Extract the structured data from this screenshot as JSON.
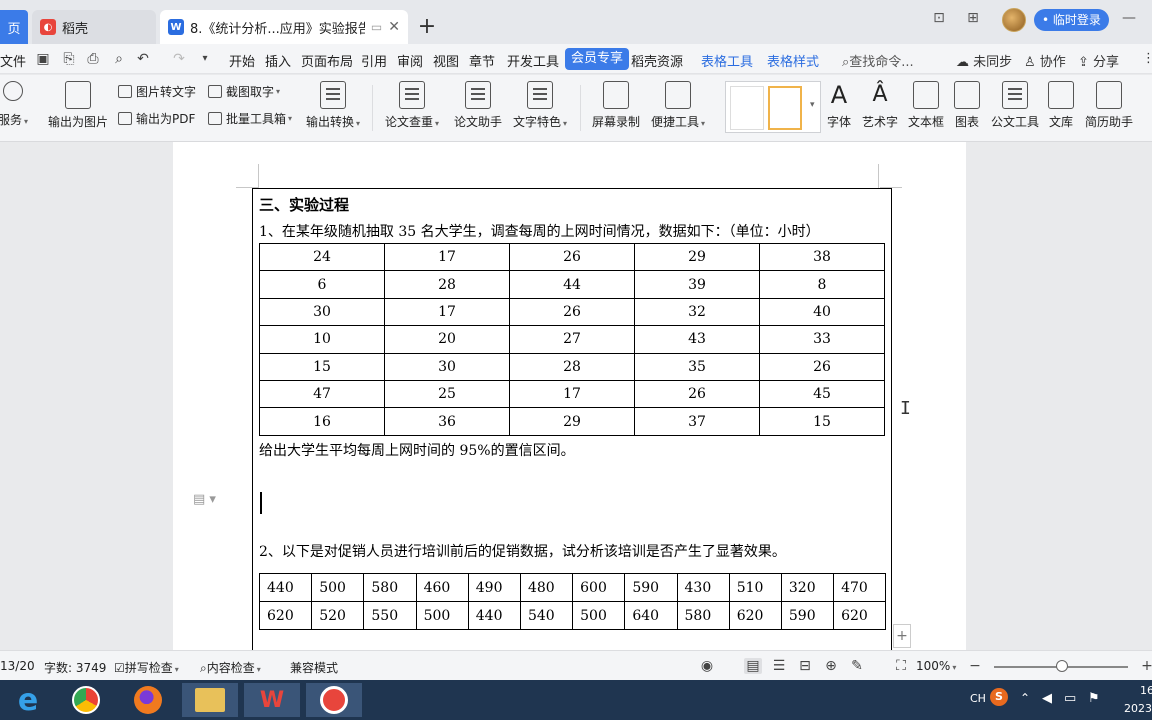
{
  "titlebar": {
    "home_tab": "页",
    "daoke_tab": "稻壳",
    "doc_tab": "8.《统计分析...应用》实验报告",
    "login_button": "• 临时登录"
  },
  "menu": {
    "file": "文件",
    "items": [
      "开始",
      "插入",
      "页面布局",
      "引用",
      "审阅",
      "视图",
      "章节",
      "开发工具"
    ],
    "member": "会员专享",
    "daoke_resources": "稻壳资源",
    "table_tools": "表格工具",
    "table_style": "表格样式",
    "search": "查找命令...",
    "sync": "未同步",
    "collab": "协作",
    "share": "分享"
  },
  "ribbon": {
    "service": "服务",
    "export_image": "输出为图片",
    "img_to_text": "图片转文字",
    "export_pdf": "输出为PDF",
    "screenshot_ocr": "截图取字",
    "batch_tools": "批量工具箱",
    "export_convert": "输出转换",
    "paper_check": "论文查重",
    "paper_assist": "论文助手",
    "text_feature": "文字特色",
    "screen_record": "屏幕录制",
    "quick_tools": "便捷工具",
    "font": "字体",
    "art_text": "艺术字",
    "text_box": "文本框",
    "chart": "图表",
    "doc_tools": "公文工具",
    "library": "文库",
    "resume": "简历助手"
  },
  "document": {
    "section_title": "三、实验过程",
    "q1": "1、在某年级随机抽取 35 名大学生，调查每周的上网时间情况，数据如下：（单位：小时）",
    "table1": [
      [
        "24",
        "17",
        "26",
        "29",
        "38"
      ],
      [
        "6",
        "28",
        "44",
        "39",
        "8"
      ],
      [
        "30",
        "17",
        "26",
        "32",
        "40"
      ],
      [
        "10",
        "20",
        "27",
        "43",
        "33"
      ],
      [
        "15",
        "30",
        "28",
        "35",
        "26"
      ],
      [
        "47",
        "25",
        "17",
        "26",
        "45"
      ],
      [
        "16",
        "36",
        "29",
        "37",
        "15"
      ]
    ],
    "q1_task": "给出大学生平均每周上网时间的 95%的置信区间。",
    "q2": "2、以下是对促销人员进行培训前后的促销数据，试分析该培训是否产生了显著效果。",
    "table2": [
      [
        "440",
        "500",
        "580",
        "460",
        "490",
        "480",
        "600",
        "590",
        "430",
        "510",
        "320",
        "470"
      ],
      [
        "620",
        "520",
        "550",
        "500",
        "440",
        "540",
        "500",
        "640",
        "580",
        "620",
        "590",
        "620"
      ]
    ]
  },
  "status": {
    "page": "13/20",
    "word_count": "字数: 3749",
    "spell_check": "拼写检查",
    "content_check": "内容检查",
    "compat_mode": "兼容模式",
    "zoom": "100%"
  },
  "taskbar": {
    "ime": "CH",
    "clock_time": "16",
    "clock_date": "2023"
  }
}
